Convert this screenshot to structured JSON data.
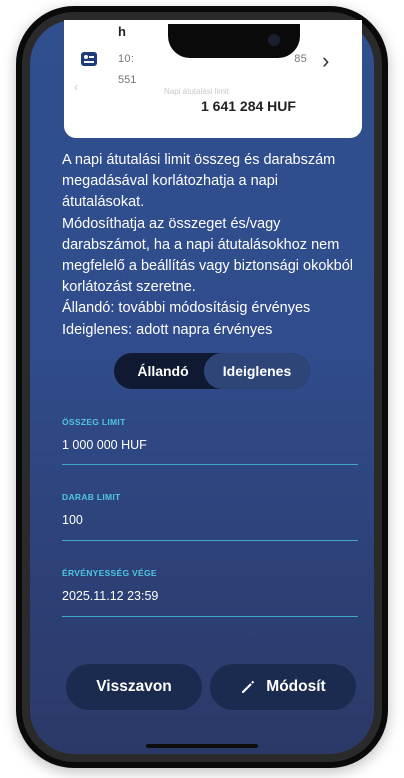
{
  "account": {
    "name": "h",
    "number_line1": "10:",
    "number_line1_tail": "85",
    "number_line2": "551",
    "limit_caption": "Napi átutalási limit",
    "limit_amount": "1 641 284 HUF"
  },
  "description": [
    "A napi átutalási limit összeg és darabszám megadásával korlátozhatja a napi átutalásokat.",
    "Módosíthatja az összeget és/vagy darabszámot, ha a napi átutalásokhoz nem megfelelő a beállítás vagy biztonsági okokból korlátozást szeretne.",
    "Állandó: további módosításig érvényes",
    "Ideiglenes: adott napra érvényes"
  ],
  "segmented": {
    "options": [
      "Állandó",
      "Ideiglenes"
    ],
    "selected": "Ideiglenes"
  },
  "fields": {
    "amount_limit": {
      "label": "ÖSSZEG LIMIT",
      "value": "1 000 000 HUF"
    },
    "count_limit": {
      "label": "DARAB LIMIT",
      "value": "100"
    },
    "valid_until": {
      "label": "ÉRVÉNYESSÉG VÉGE",
      "value": "2025.11.12 23:59"
    }
  },
  "buttons": {
    "cancel": "Visszavon",
    "edit": "Módosít"
  },
  "colors": {
    "accent_label": "#4fc6e0",
    "background": "#2f4f8e",
    "button_bg": "#1b2b4f"
  }
}
